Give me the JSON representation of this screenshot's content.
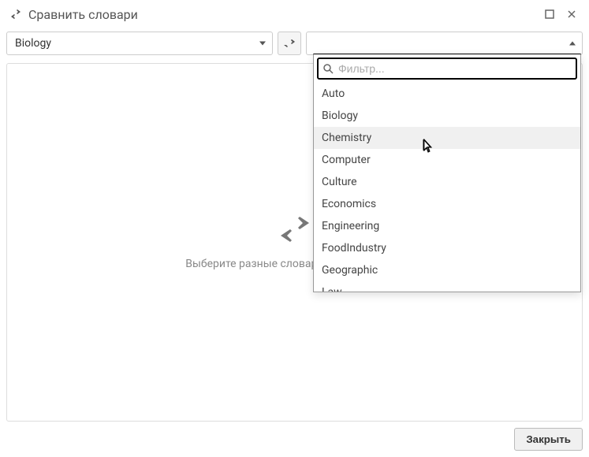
{
  "window": {
    "title": "Сравнить словари"
  },
  "left_select": {
    "value": "Biology"
  },
  "right_select": {
    "value": ""
  },
  "dropdown": {
    "filter_placeholder": "Фильтр...",
    "items": [
      "Auto",
      "Biology",
      "Chemistry",
      "Computer",
      "Culture",
      "Economics",
      "Engineering",
      "FoodIndustry",
      "Geographic",
      "Law"
    ],
    "hover_index": 2
  },
  "content": {
    "hint": "Выберите разные словари для сравнения"
  },
  "footer": {
    "close_label": "Закрыть"
  }
}
